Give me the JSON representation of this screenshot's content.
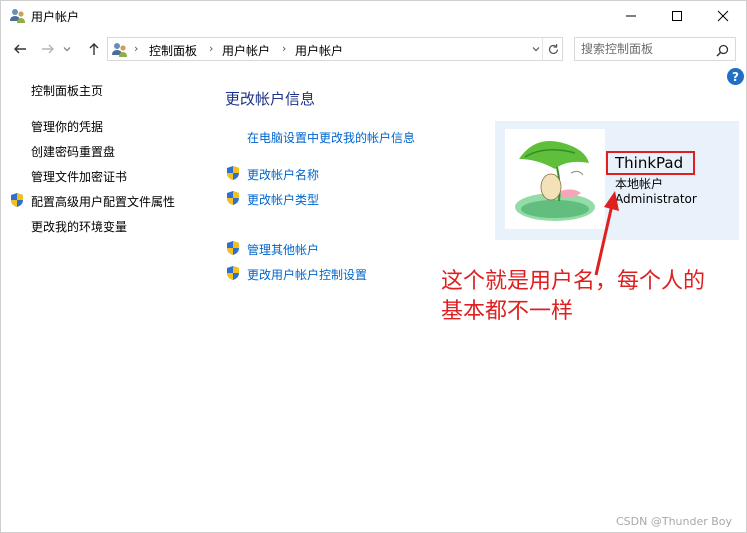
{
  "window": {
    "title": "用户帐户",
    "controls": {
      "minimize": "minimize-icon",
      "maximize": "maximize-icon",
      "close": "close-icon"
    }
  },
  "navbar": {
    "breadcrumbs": [
      "控制面板",
      "用户帐户",
      "用户帐户"
    ],
    "search_placeholder": "搜索控制面板"
  },
  "sidebar": {
    "home_link": "控制面板主页",
    "links": [
      "管理你的凭据",
      "创建密码重置盘",
      "管理文件加密证书",
      "配置高级用户配置文件属性",
      "更改我的环境变量"
    ]
  },
  "main": {
    "title": "更改帐户信息",
    "pc_settings_link": "在电脑设置中更改我的帐户信息",
    "links_group1": [
      "更改帐户名称",
      "更改帐户类型"
    ],
    "links_group2": [
      "管理其他帐户",
      "更改用户帐户控制设置"
    ]
  },
  "user": {
    "name": "ThinkPad",
    "account_type": "本地帐户",
    "group": "Administrator"
  },
  "annotation": {
    "line1": "这个就是用户名，每个人的",
    "line2": "基本都不一样"
  },
  "watermark": "CSDN @Thunder Boy",
  "colors": {
    "title_blue": "#1e3287",
    "link_blue": "#0066cc",
    "annotation_red": "#e02020",
    "card_bg": "#e9f2fb"
  }
}
